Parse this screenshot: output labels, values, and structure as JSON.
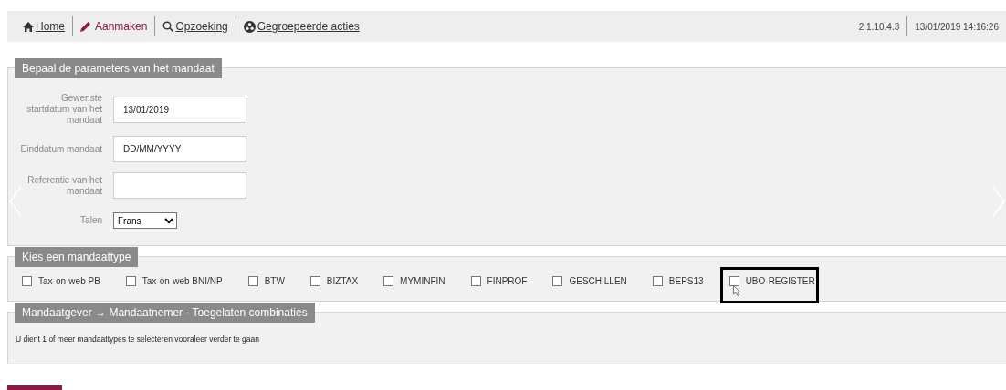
{
  "nav": {
    "items": [
      {
        "label": "Home",
        "selected": false
      },
      {
        "label": "Aanmaken",
        "selected": true
      },
      {
        "label": "Opzoeking",
        "selected": false
      },
      {
        "label": "Gegroepeerde acties",
        "selected": false
      }
    ],
    "version": "2.1.10.4.3",
    "datetime": "13/01/2019 14:16:26"
  },
  "parameters": {
    "title": "Bepaal de parameters van het mandaat",
    "fields": [
      {
        "kind": "input",
        "label": "Gewenste startdatum van het mandaat",
        "value": "13/01/2019"
      },
      {
        "kind": "input",
        "label": "Einddatum mandaat",
        "placeholder": "DD/MM/YYYY"
      },
      {
        "kind": "input",
        "label": "Referentie van het mandaat"
      },
      {
        "kind": "select",
        "label": "Talen",
        "value": "Frans"
      }
    ]
  },
  "mandate_types": {
    "title": "Kies een mandaattype",
    "options": [
      {
        "label": "Tax-on-web PB",
        "checked": false,
        "highlighted": false
      },
      {
        "label": "Tax-on-web BNI/NP",
        "checked": false,
        "highlighted": false
      },
      {
        "label": "BTW",
        "checked": false,
        "highlighted": false
      },
      {
        "label": "BIZTAX",
        "checked": false,
        "highlighted": false
      },
      {
        "label": "MYMINFIN",
        "checked": false,
        "highlighted": false
      },
      {
        "label": "FINPROF",
        "checked": false,
        "highlighted": false
      },
      {
        "label": "GESCHILLEN",
        "checked": false,
        "highlighted": false
      },
      {
        "label": "BEPS13",
        "checked": false,
        "highlighted": false
      },
      {
        "label": "UBO-REGISTER",
        "checked": false,
        "highlighted": true
      }
    ]
  },
  "combinations": {
    "title": "Mandaatgever → Mandaatnemer - Toegelaten combinaties",
    "message": "U dient 1 of meer mandaattypes te selecteren vooraleer verder te gaan"
  }
}
